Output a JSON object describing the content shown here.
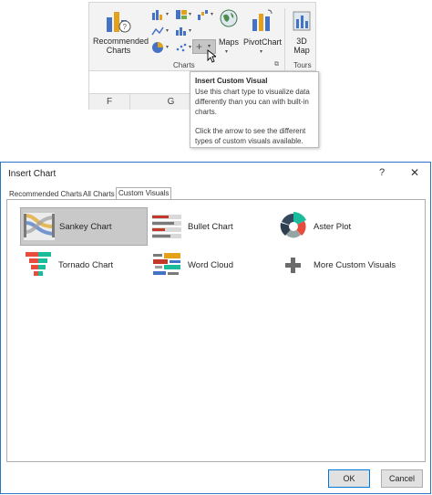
{
  "ribbon": {
    "recommended_charts": "Recommended Charts",
    "maps": "Maps",
    "pivotchart": "PivotChart",
    "map3d": "3D Map",
    "group_charts": "Charts",
    "group_tours": "Tours"
  },
  "sheet": {
    "col_f": "F",
    "col_g": "G"
  },
  "tooltip": {
    "title": "Insert Custom Visual",
    "line1": "Use this chart type to visualize data differently than you can with built-in charts.",
    "line2": "Click the arrow to see the different types of custom visuals available."
  },
  "dialog": {
    "title": "Insert Chart",
    "help": "?",
    "close": "✕",
    "tabs": [
      "Recommended Charts",
      "All Charts",
      "Custom Visuals"
    ],
    "items": [
      {
        "label": "Sankey Chart",
        "icon": "sankey-icon",
        "selected": true
      },
      {
        "label": "Bullet Chart",
        "icon": "bullet-chart-icon"
      },
      {
        "label": "Aster Plot",
        "icon": "aster-plot-icon"
      },
      {
        "label": "Tornado Chart",
        "icon": "tornado-chart-icon"
      },
      {
        "label": "Word Cloud",
        "icon": "word-cloud-icon"
      },
      {
        "label": "More Custom Visuals",
        "icon": "plus-icon"
      }
    ],
    "ok": "OK",
    "cancel": "Cancel"
  },
  "colors": {
    "dialog_border": "#2b78c4",
    "selected_bg": "#c9c9c9",
    "ok_border": "#0078d7"
  }
}
